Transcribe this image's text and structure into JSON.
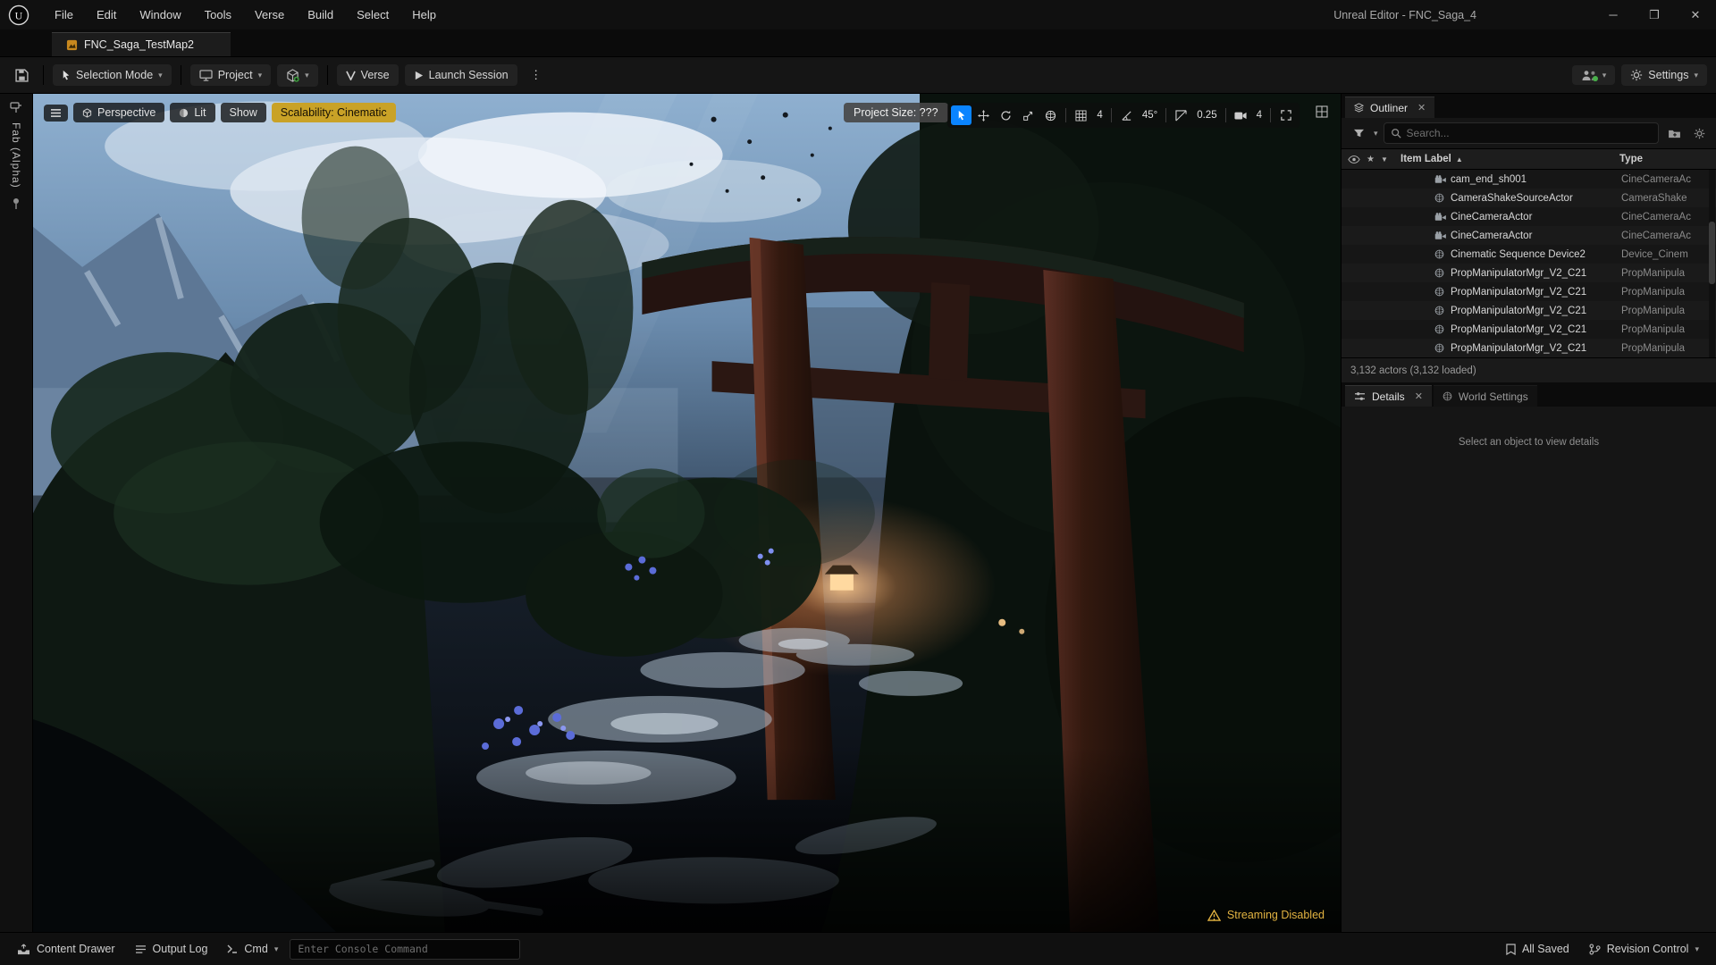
{
  "titlebar": {
    "menus": [
      "File",
      "Edit",
      "Window",
      "Tools",
      "Verse",
      "Build",
      "Select",
      "Help"
    ],
    "window_title": "Unreal Editor - FNC_Saga_4"
  },
  "tabbar": {
    "map_tab": "FNC_Saga_TestMap2"
  },
  "toolbar": {
    "selection_mode": "Selection Mode",
    "project": "Project",
    "verse": "Verse",
    "launch_session": "Launch Session",
    "settings": "Settings"
  },
  "viewport": {
    "menu": [
      "Perspective",
      "Lit",
      "Show"
    ],
    "scalability": "Scalability: Cinematic",
    "project_size": "Project Size: ???",
    "snap": {
      "grid": "4",
      "angle": "45°",
      "scale": "0.25",
      "camera_speed": "4"
    },
    "streaming_warning": "Streaming Disabled"
  },
  "left_strip": {
    "fab_label": "Fab (Alpha)"
  },
  "outliner": {
    "title": "Outliner",
    "search_placeholder": "Search...",
    "columns": {
      "item_label": "Item Label",
      "type": "Type"
    },
    "rows": [
      {
        "label": "cam_end_sh001",
        "type": "CineCameraAc",
        "icon": "camera"
      },
      {
        "label": "CameraShakeSourceActor",
        "type": "CameraShake",
        "icon": "sphere"
      },
      {
        "label": "CineCameraActor",
        "type": "CineCameraAc",
        "icon": "camera"
      },
      {
        "label": "CineCameraActor",
        "type": "CineCameraAc",
        "icon": "camera"
      },
      {
        "label": "Cinematic Sequence Device2",
        "type": "Device_Cinem",
        "icon": "sphere"
      },
      {
        "label": "PropManipulatorMgr_V2_C21",
        "type": "PropManipula",
        "icon": "sphere"
      },
      {
        "label": "PropManipulatorMgr_V2_C21",
        "type": "PropManipula",
        "icon": "sphere"
      },
      {
        "label": "PropManipulatorMgr_V2_C21",
        "type": "PropManipula",
        "icon": "sphere"
      },
      {
        "label": "PropManipulatorMgr_V2_C21",
        "type": "PropManipula",
        "icon": "sphere"
      },
      {
        "label": "PropManipulatorMgr_V2_C21",
        "type": "PropManipula",
        "icon": "sphere"
      }
    ],
    "footer": "3,132 actors (3,132 loaded)"
  },
  "details": {
    "tabs": [
      "Details",
      "World Settings"
    ],
    "empty_message": "Select an object to view details"
  },
  "statusbar": {
    "content_drawer": "Content Drawer",
    "output_log": "Output Log",
    "cmd": "Cmd",
    "console_placeholder": "Enter Console Command",
    "all_saved": "All Saved",
    "revision_control": "Revision Control"
  },
  "colors": {
    "accent_blue": "#0a84ff",
    "warning_yellow": "#e3b341",
    "scalability_yellow": "#c9a227",
    "tab_orange": "#c8881e"
  }
}
